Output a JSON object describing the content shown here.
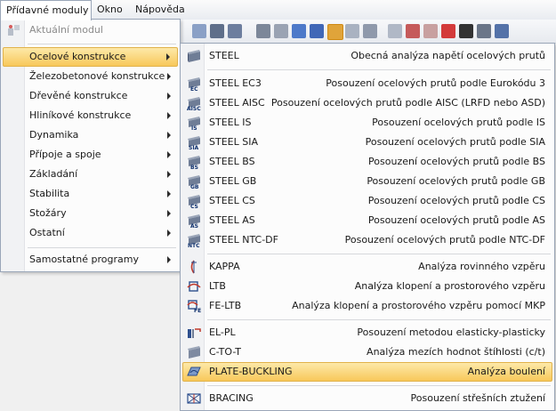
{
  "menubar": {
    "items": [
      {
        "label": "Přídavné moduly",
        "active": true
      },
      {
        "label": "Okno",
        "active": false
      },
      {
        "label": "Nápověda",
        "active": false
      }
    ]
  },
  "menu": {
    "items": [
      {
        "label": "Aktuální modul",
        "disabled": true,
        "icon": "current-module-icon"
      },
      {
        "label": "Ocelové konstrukce",
        "highlighted": true,
        "submenu": true
      },
      {
        "label": "Železobetonové konstrukce",
        "submenu": true
      },
      {
        "label": "Dřevěné konstrukce",
        "submenu": true
      },
      {
        "label": "Hliníkové konstrukce",
        "submenu": true
      },
      {
        "label": "Dynamika",
        "submenu": true
      },
      {
        "label": "Přípoje a spoje",
        "submenu": true
      },
      {
        "label": "Základání",
        "submenu": true
      },
      {
        "label": "Stabilita",
        "submenu": true
      },
      {
        "label": "Stožáry",
        "submenu": true
      },
      {
        "label": "Ostatní",
        "submenu": true
      },
      {
        "label": "Samostatné programy",
        "submenu": true
      }
    ]
  },
  "submenu": {
    "items": [
      {
        "code": "STEEL",
        "desc": "Obecná analýza napětí ocelových prutů",
        "badge": ""
      },
      {
        "code": "STEEL EC3",
        "desc": "Posouzení ocelových prutů podle Eurokódu 3",
        "badge": "EC"
      },
      {
        "code": "STEEL AISC",
        "desc": "Posouzení ocelových prutů podle AISC (LRFD nebo ASD)",
        "badge": "AISC"
      },
      {
        "code": "STEEL IS",
        "desc": "Posouzení ocelových prutů podle IS",
        "badge": "IS"
      },
      {
        "code": "STEEL SIA",
        "desc": "Posouzení ocelových prutů podle SIA",
        "badge": "SIA"
      },
      {
        "code": "STEEL BS",
        "desc": "Posouzení ocelových prutů podle BS",
        "badge": "BS"
      },
      {
        "code": "STEEL GB",
        "desc": "Posouzení ocelových prutů podle GB",
        "badge": "GB"
      },
      {
        "code": "STEEL CS",
        "desc": "Posouzení ocelových prutů podle CS",
        "badge": "CS"
      },
      {
        "code": "STEEL AS",
        "desc": "Posouzení ocelových prutů podle AS",
        "badge": "AS"
      },
      {
        "code": "STEEL NTC-DF",
        "desc": "Posouzení ocelových prutů podle NTC-DF",
        "badge": "NTC"
      },
      {
        "code": "KAPPA",
        "desc": "Analýza rovinného vzpěru",
        "badge": ""
      },
      {
        "code": "LTB",
        "desc": "Analýza klopení a prostorového vzpěru",
        "badge": ""
      },
      {
        "code": "FE-LTB",
        "desc": "Analýza klopení a prostorového vzpěru pomocí MKP",
        "badge": "FE"
      },
      {
        "code": "EL-PL",
        "desc": "Posouzení metodou elasticky-plasticky",
        "badge": ""
      },
      {
        "code": "C-TO-T",
        "desc": "Analýza mezích hodnot štíhlosti (c/t)",
        "badge": ""
      },
      {
        "code": "PLATE-BUCKLING",
        "desc": "Analýza boulení",
        "badge": ""
      },
      {
        "code": "BRACING",
        "desc": "Posouzení střešních ztužení",
        "badge": ""
      }
    ]
  },
  "colors": {
    "highlight_top": "#fde9a9",
    "highlight_bottom": "#f8c85a",
    "menu_border": "#9aa6b8"
  }
}
